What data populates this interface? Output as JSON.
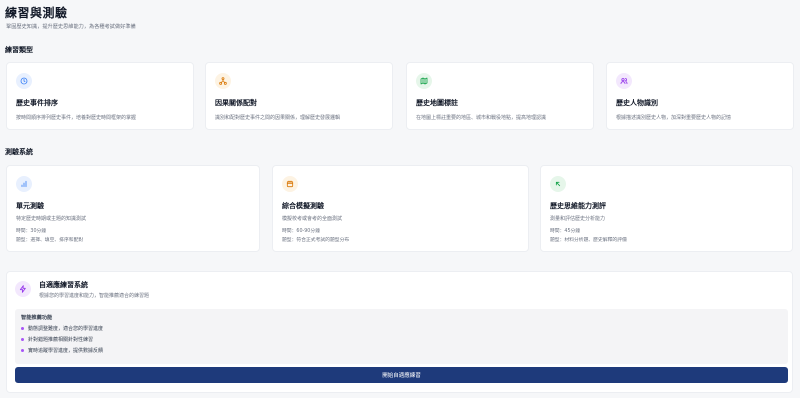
{
  "header": {
    "title": "練習與測驗",
    "subtitle": "鞏固歷史知識，提升歷史思維能力，為各種考試做好準備"
  },
  "practice": {
    "section_title": "練習類型",
    "cards": [
      {
        "title": "歷史事件排序",
        "desc": "按時間順序排列歷史事件，培養對歷史時間框架的掌握",
        "icon": "clock-icon",
        "icon_color": "#3b82f6",
        "icon_bg": "#e8f0fe"
      },
      {
        "title": "因果關係配對",
        "desc": "識別和配對歷史事件之間的因果關係，理解歷史發展邏輯",
        "icon": "network-icon",
        "icon_color": "#d97706",
        "icon_bg": "#fdf3e3"
      },
      {
        "title": "歷史地圖標註",
        "desc": "在地圖上標註重要的地區、城市和戰役地點，提高地理認識",
        "icon": "map-icon",
        "icon_color": "#16a34a",
        "icon_bg": "#e6f6ea"
      },
      {
        "title": "歷史人物識別",
        "desc": "根據描述識別歷史人物，加深對重要歷史人物的記憶",
        "icon": "users-icon",
        "icon_color": "#9333ea",
        "icon_bg": "#f3e8fd"
      }
    ]
  },
  "quiz": {
    "section_title": "測驗系統",
    "cards": [
      {
        "title": "單元測驗",
        "desc": "特定歷史時期或主題的知識測試",
        "time": "時間：30分鐘",
        "types": "題型：選擇、填空、排序和配對",
        "icon": "bar-chart-icon",
        "icon_color": "#3b82f6",
        "icon_bg": "#e8f0fe"
      },
      {
        "title": "綜合模擬測驗",
        "desc": "模擬校考或會考的全面測試",
        "time": "時間：60-90分鐘",
        "types": "題型：符合正式考試的題型分布",
        "icon": "calendar-icon",
        "icon_color": "#d97706",
        "icon_bg": "#fdf3e3"
      },
      {
        "title": "歷史思維能力測評",
        "desc": "測量和評估歷史分析能力",
        "time": "時間：45分鐘",
        "types": "題型：材料分析題、歷史解釋的評價",
        "icon": "arrow-up-left-icon",
        "icon_color": "#16a34a",
        "icon_bg": "#e6f6ea"
      }
    ]
  },
  "adaptive": {
    "title": "自適應練習系統",
    "desc": "根據您的學習進度和能力，智能推薦適合的練習題",
    "icon": "lightning-icon",
    "icon_color": "#9333ea",
    "icon_bg": "#f3e8fd",
    "features_title": "智能推薦功能",
    "features": [
      "動態調整難度，適合您的學習進度",
      "針對錯題推薦相關針對性練習",
      "實時追蹤學習進度，提供數據反饋"
    ],
    "button_label": "開始自適應練習"
  }
}
